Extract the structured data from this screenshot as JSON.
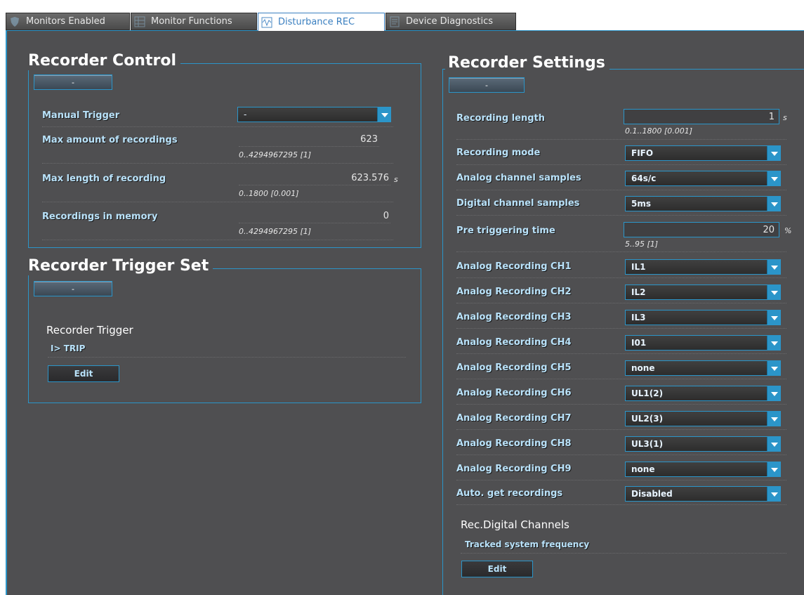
{
  "tabs": [
    {
      "label": "Monitors Enabled",
      "icon": "shield-icon"
    },
    {
      "label": "Monitor Functions",
      "icon": "grid-icon"
    },
    {
      "label": "Disturbance REC",
      "icon": "disturbance-icon"
    },
    {
      "label": "Device Diagnostics",
      "icon": "diagnostics-icon"
    }
  ],
  "recorder_control": {
    "title": "Recorder Control",
    "collapse_label": "-",
    "manual_trigger": {
      "label": "Manual Trigger",
      "value": "-"
    },
    "max_amount": {
      "label": "Max amount of recordings",
      "value": "623",
      "range": "0..4294967295 [1]"
    },
    "max_length": {
      "label": "Max length of recording",
      "value": "623.576",
      "unit": "s",
      "range": "0..1800 [0.001]"
    },
    "in_memory": {
      "label": "Recordings in memory",
      "value": "0",
      "range": "0..4294967295 [1]"
    }
  },
  "trigger_set": {
    "title": "Recorder Trigger Set",
    "collapse_label": "-",
    "subheading": "Recorder Trigger",
    "item": "I> TRIP",
    "edit_label": "Edit"
  },
  "recorder_settings": {
    "title": "Recorder Settings",
    "collapse_label": "-",
    "recording_length": {
      "label": "Recording length",
      "value": "1",
      "unit": "s",
      "range": "0.1..1800 [0.001]"
    },
    "recording_mode": {
      "label": "Recording mode",
      "value": "FIFO"
    },
    "analog_samples": {
      "label": "Analog channel samples",
      "value": "64s/c"
    },
    "digital_samples": {
      "label": "Digital channel samples",
      "value": "5ms"
    },
    "pre_trigger": {
      "label": "Pre triggering time",
      "value": "20",
      "unit": "%",
      "range": "5..95 [1]"
    },
    "channels": [
      {
        "label": "Analog Recording CH1",
        "value": "IL1"
      },
      {
        "label": "Analog Recording CH2",
        "value": "IL2"
      },
      {
        "label": "Analog Recording CH3",
        "value": "IL3"
      },
      {
        "label": "Analog Recording CH4",
        "value": "I01"
      },
      {
        "label": "Analog Recording CH5",
        "value": "none"
      },
      {
        "label": "Analog Recording CH6",
        "value": "UL1(2)"
      },
      {
        "label": "Analog Recording CH7",
        "value": "UL2(3)"
      },
      {
        "label": "Analog Recording CH8",
        "value": "UL3(1)"
      },
      {
        "label": "Analog Recording CH9",
        "value": "none"
      }
    ],
    "auto_get": {
      "label": "Auto. get recordings",
      "value": "Disabled"
    },
    "digital_channels": {
      "heading": "Rec.Digital Channels",
      "item": "Tracked system frequency",
      "edit_label": "Edit"
    }
  },
  "colors": {
    "accent": "#2b95c9",
    "label": "#b9e2fa",
    "background": "#4f4f51"
  }
}
